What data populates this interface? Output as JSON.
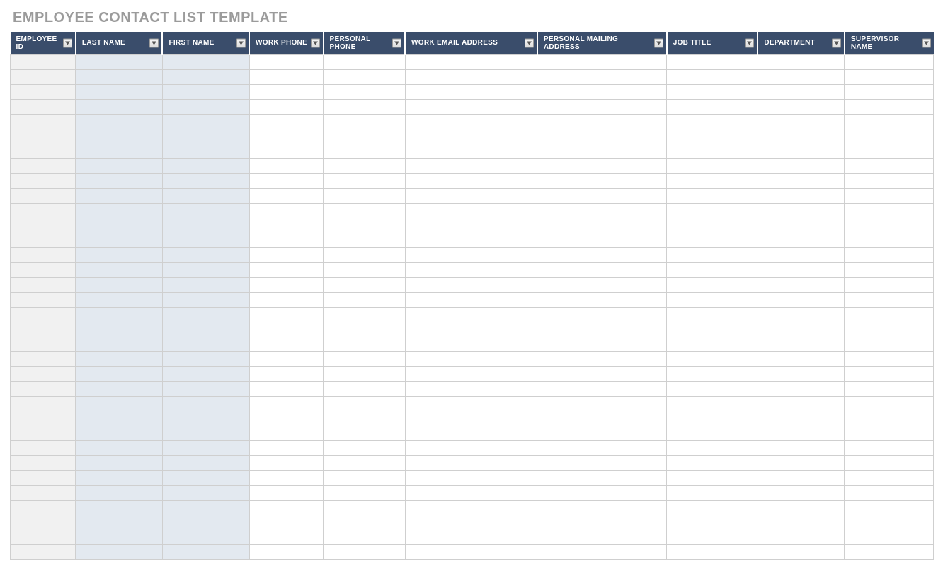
{
  "title": "EMPLOYEE CONTACT LIST TEMPLATE",
  "columns": [
    {
      "label": "EMPLOYEE ID",
      "shade": "id"
    },
    {
      "label": "LAST NAME",
      "shade": "name"
    },
    {
      "label": "FIRST NAME",
      "shade": "name"
    },
    {
      "label": "WORK PHONE",
      "shade": "plain"
    },
    {
      "label": "PERSONAL PHONE",
      "shade": "plain"
    },
    {
      "label": "WORK EMAIL ADDRESS",
      "shade": "plain"
    },
    {
      "label": "PERSONAL MAILING ADDRESS",
      "shade": "plain"
    },
    {
      "label": "JOB TITLE",
      "shade": "plain"
    },
    {
      "label": "DEPARTMENT",
      "shade": "plain"
    },
    {
      "label": "SUPERVISOR NAME",
      "shade": "plain"
    }
  ],
  "row_count": 34,
  "colors": {
    "header_bg": "#3a4d6b",
    "id_shade": "#f1f1f1",
    "name_shade": "#e3e9f0",
    "grid": "#cfcfcf",
    "title": "#9b9b9b"
  }
}
